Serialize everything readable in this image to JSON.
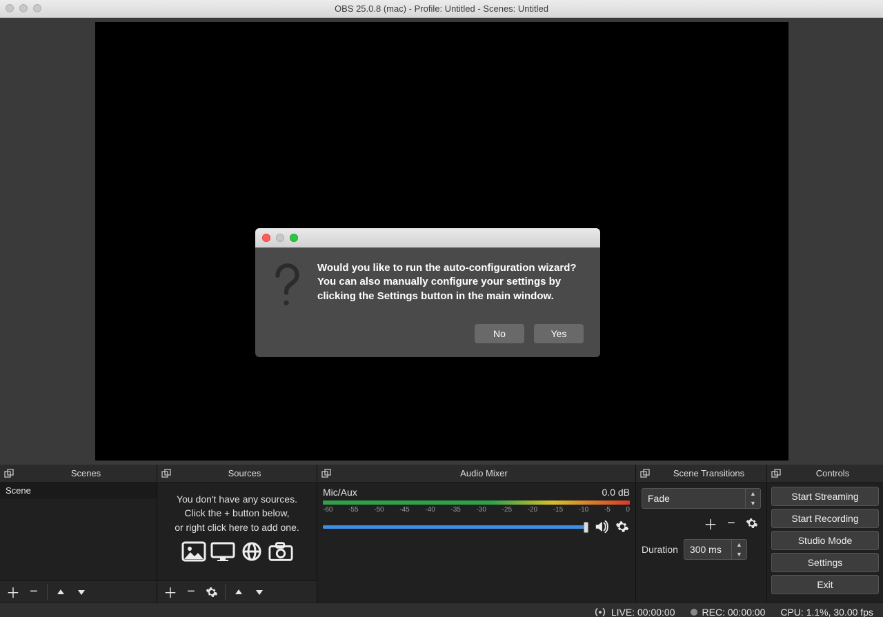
{
  "titlebar": {
    "title": "OBS 25.0.8 (mac) - Profile: Untitled - Scenes: Untitled"
  },
  "docks": {
    "scenes": {
      "title": "Scenes",
      "items": [
        "Scene"
      ]
    },
    "sources": {
      "title": "Sources",
      "empty_line1": "You don't have any sources.",
      "empty_line2": "Click the + button below,",
      "empty_line3": "or right click here to add one."
    },
    "mixer": {
      "title": "Audio Mixer",
      "channel_name": "Mic/Aux",
      "channel_db": "0.0 dB",
      "ticks": [
        "-60",
        "-55",
        "-50",
        "-45",
        "-40",
        "-35",
        "-30",
        "-25",
        "-20",
        "-15",
        "-10",
        "-5",
        "0"
      ]
    },
    "transitions": {
      "title": "Scene Transitions",
      "selected": "Fade",
      "duration_label": "Duration",
      "duration_value": "300 ms"
    },
    "controls": {
      "title": "Controls",
      "buttons": [
        "Start Streaming",
        "Start Recording",
        "Studio Mode",
        "Settings",
        "Exit"
      ]
    }
  },
  "statusbar": {
    "live": "LIVE: 00:00:00",
    "rec": "REC: 00:00:00",
    "cpu": "CPU: 1.1%, 30.00 fps"
  },
  "dialog": {
    "message": "Would you like to run the auto-configuration wizard? You can also manually configure your settings by clicking the Settings button in the main window.",
    "no": "No",
    "yes": "Yes"
  }
}
